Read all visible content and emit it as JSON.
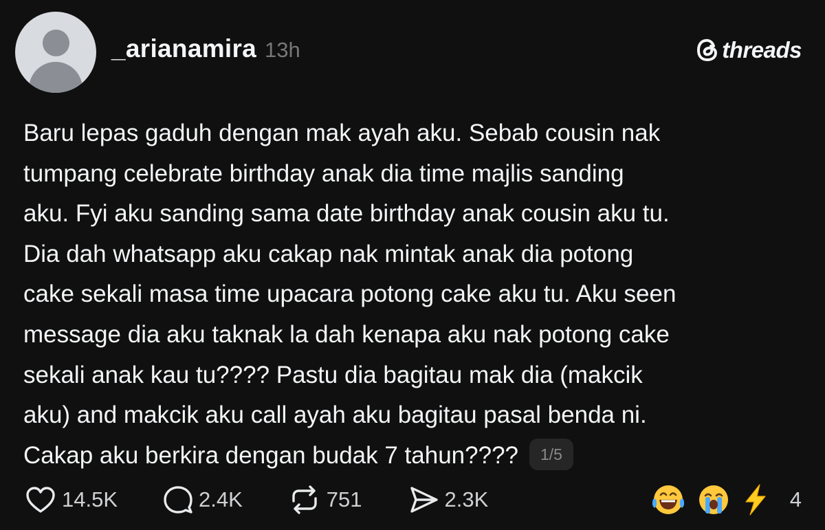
{
  "post": {
    "author": {
      "username": "_arianamira",
      "timestamp": "13h",
      "avatar_icon": "default-avatar-icon"
    },
    "brand": {
      "logo_icon": "threads-logo-icon",
      "name": "threads"
    },
    "text_lines": [
      "Baru lepas gaduh dengan mak ayah aku. Sebab cousin nak",
      "tumpang celebrate birthday anak dia time majlis sanding",
      "aku. Fyi aku sanding sama date birthday anak cousin aku tu.",
      "Dia dah whatsapp aku cakap nak mintak anak dia potong",
      "cake sekali masa time upacara potong cake aku tu. Aku seen",
      "message dia aku taknak la dah kenapa aku nak potong cake",
      "sekali anak kau tu???? Pastu dia bagitau mak dia (makcik",
      "aku) and makcik aku call ayah aku bagitau pasal benda ni.",
      "Cakap aku berkira dengan budak 7 tahun????"
    ],
    "pager": "1/5",
    "actions": {
      "like": {
        "icon": "heart-icon",
        "count": "14.5K"
      },
      "comment": {
        "icon": "comment-bubble-icon",
        "count": "2.4K"
      },
      "repost": {
        "icon": "repost-icon",
        "count": "751"
      },
      "share": {
        "icon": "send-icon",
        "count": "2.3K"
      }
    },
    "reactions": {
      "icons": [
        "laughing-tears-emoji-icon",
        "crying-emoji-icon",
        "lightning-emoji-icon"
      ],
      "count": "4"
    },
    "colors": {
      "background": "#101010",
      "text": "#f3f5f7",
      "muted": "#777777",
      "pager_bg": "#262626"
    }
  }
}
